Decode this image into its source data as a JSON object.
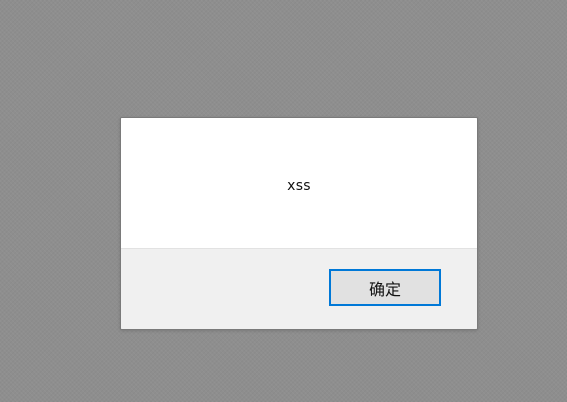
{
  "dialog": {
    "message": "xss",
    "ok_label": "确定"
  },
  "colors": {
    "overlay": "#8e8e8e",
    "dialog_body": "#ffffff",
    "dialog_footer": "#f0f0f0",
    "button_face": "#e1e1e1",
    "button_focus_border": "#0078d7"
  }
}
